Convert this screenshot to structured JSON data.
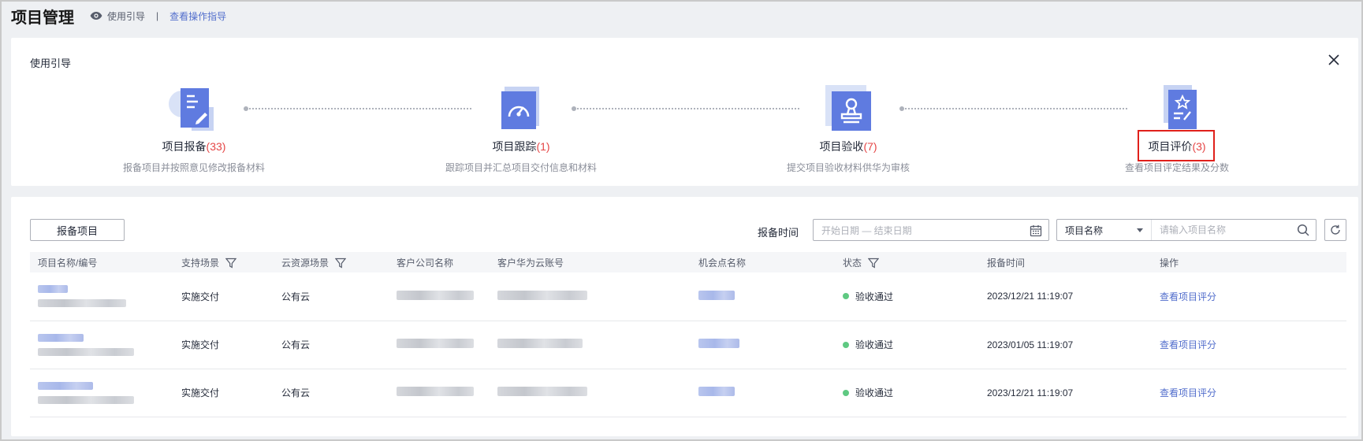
{
  "header": {
    "title": "项目管理",
    "guide_label": "使用引导",
    "separator": "|",
    "doc_link": "查看操作指导"
  },
  "guide": {
    "title": "使用引导",
    "steps": [
      {
        "name": "项目报备",
        "count": "(33)",
        "desc": "报备项目并按照意见修改报备材料"
      },
      {
        "name": "项目跟踪",
        "count": "(1)",
        "desc": "跟踪项目并汇总项目交付信息和材料"
      },
      {
        "name": "项目验收",
        "count": "(7)",
        "desc": "提交项目验收材料供华为审核"
      },
      {
        "name": "项目评价",
        "count": "(3)",
        "desc": "查看项目评定结果及分数"
      }
    ]
  },
  "toolbar": {
    "report_button": "报备项目",
    "date_label": "报备时间",
    "date_placeholder": "开始日期 — 结束日期",
    "select_value": "项目名称",
    "search_placeholder": "请输入项目名称"
  },
  "table": {
    "columns": [
      "项目名称/编号",
      "支持场景",
      "云资源场景",
      "客户公司名称",
      "客户华为云账号",
      "机会点名称",
      "状态",
      "报备时间",
      "操作"
    ],
    "rows": [
      {
        "scene": "实施交付",
        "cloud": "公有云",
        "status": "验收通过",
        "time": "2023/12/21 11:19:07",
        "action": "查看项目评分"
      },
      {
        "scene": "实施交付",
        "cloud": "公有云",
        "status": "验收通过",
        "time": "2023/01/05 11:19:07",
        "action": "查看项目评分"
      },
      {
        "scene": "实施交付",
        "cloud": "公有云",
        "status": "验收通过",
        "time": "2023/12/21 11:19:07",
        "action": "查看项目评分"
      }
    ]
  },
  "colors": {
    "accent": "#526ecc",
    "count_red": "#e54545",
    "status_green": "#5fc982",
    "highlight_red": "#e0201b"
  }
}
